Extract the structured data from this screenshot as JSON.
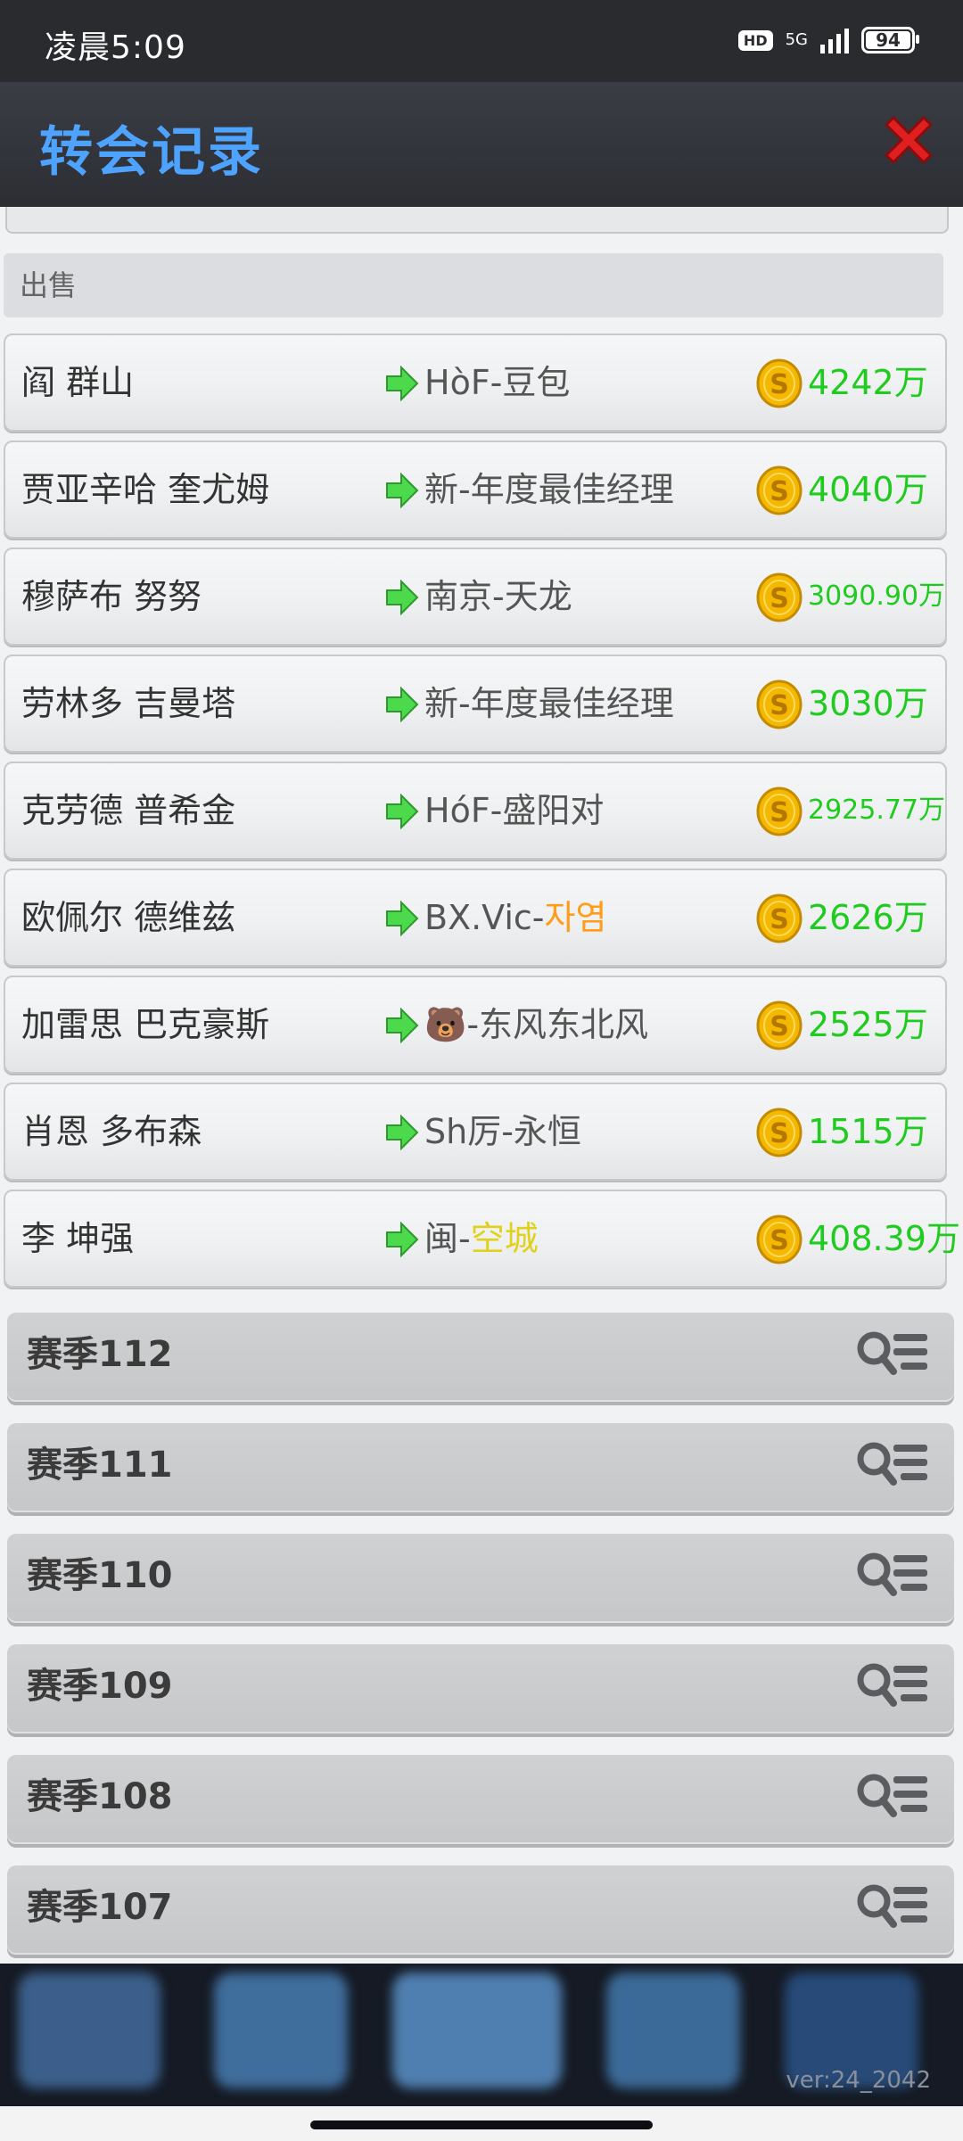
{
  "status_bar": {
    "time": "凌晨5:09",
    "hd": "HD",
    "network": "5G",
    "battery": "94"
  },
  "header": {
    "title": "转会记录",
    "close_icon": "close-icon",
    "title_color": "#4ea3ff",
    "close_color": "#e02020"
  },
  "section": {
    "label": "出售"
  },
  "transfers": [
    {
      "player": "阎 群山",
      "team": "HòF-豆包",
      "team_highlight": "",
      "price": "4242万",
      "small": false
    },
    {
      "player": "贾亚辛哈 奎尤姆",
      "team": "新-年度最佳经理",
      "team_highlight": "",
      "price": "4040万",
      "small": false
    },
    {
      "player": "穆萨布 努努",
      "team": "南京-天龙",
      "team_highlight": "",
      "price": "3090.90万",
      "small": true
    },
    {
      "player": "劳林多 吉曼塔",
      "team": "新-年度最佳经理",
      "team_highlight": "",
      "price": "3030万",
      "small": false
    },
    {
      "player": "克劳德 普希金",
      "team": "HóF-盛阳对",
      "team_highlight": "",
      "price": "2925.77万",
      "small": true
    },
    {
      "player": "欧佩尔 德维兹",
      "team": "BX.Vic-",
      "team_highlight": "자염",
      "highlight_color": "orange",
      "price": "2626万",
      "small": false
    },
    {
      "player": "加雷思 巴克豪斯",
      "team": "🐻-东风东北风",
      "team_highlight": "",
      "price": "2525万",
      "small": false
    },
    {
      "player": "肖恩 多布森",
      "team": "Sh厉-永恒",
      "team_highlight": "",
      "price": "1515万",
      "small": false
    },
    {
      "player": "李 坤强",
      "team": "闽-",
      "team_highlight": "空城",
      "highlight_color": "yellow",
      "price": "408.39万",
      "small": false
    }
  ],
  "seasons": [
    {
      "label": "赛季112"
    },
    {
      "label": "赛季111"
    },
    {
      "label": "赛季110"
    },
    {
      "label": "赛季109"
    },
    {
      "label": "赛季108"
    },
    {
      "label": "赛季107"
    }
  ],
  "footer": {
    "version": "ver:24_2042"
  },
  "colors": {
    "price_green": "#1fcb1f",
    "arrow_green": "#4cd94c",
    "coin_gold": "#f5b800"
  }
}
